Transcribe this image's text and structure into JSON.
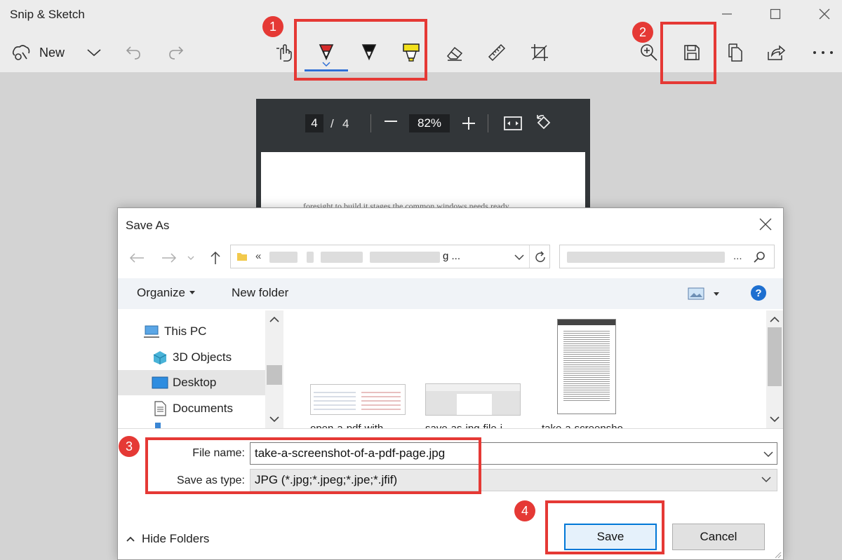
{
  "app": {
    "title": "Snip & Sketch",
    "new_label": "New"
  },
  "toolbar": {
    "icons": [
      "touch-writing-icon",
      "ballpoint-pen-icon",
      "pencil-icon",
      "highlighter-icon",
      "eraser-icon",
      "ruler-icon",
      "crop-icon",
      "zoom-icon",
      "save-icon",
      "copy-icon",
      "share-icon",
      "more-icon"
    ]
  },
  "annotations": {
    "step1": "1",
    "step2": "2",
    "step3": "3",
    "step4": "4",
    "color": "#e53935"
  },
  "pdf_viewer": {
    "current_page": "4",
    "page_sep": "/",
    "total_pages": "4",
    "zoom": "82%",
    "text_line": "foresight to build it stages the common windows needs ready"
  },
  "dialog": {
    "title": "Save As",
    "address_prefix": "«",
    "address_tail": "g ...",
    "search_tail": "...",
    "organize_label": "Organize",
    "new_folder_label": "New folder",
    "tree_items": [
      {
        "label": "This PC"
      },
      {
        "label": "3D Objects"
      },
      {
        "label": "Desktop"
      },
      {
        "label": "Documents"
      }
    ],
    "files": [
      {
        "label": "open-a-pdf-with..."
      },
      {
        "label": "save-as-jpg-file-i..."
      },
      {
        "label": "take-a-screensho..."
      }
    ],
    "file_name_label": "File name:",
    "file_name_value": "take-a-screenshot-of-a-pdf-page.jpg",
    "save_type_label": "Save as type:",
    "save_type_value": "JPG (*.jpg;*.jpeg;*.jpe;*.jfif)",
    "hide_folders_label": "Hide Folders",
    "save_label": "Save",
    "cancel_label": "Cancel"
  },
  "colors": {
    "accent_blue": "#0078d7",
    "pen_red": "#d62b2b",
    "pen_yellow": "#f2e01c"
  }
}
